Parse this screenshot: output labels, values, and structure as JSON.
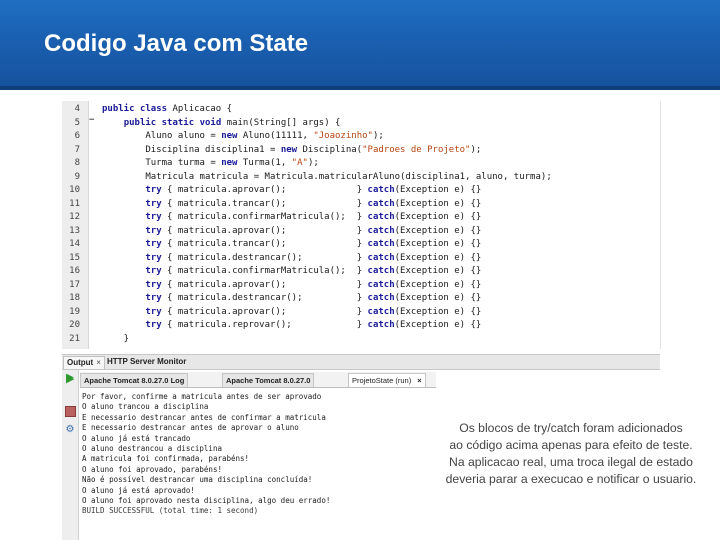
{
  "header": {
    "title": "Codigo Java com State"
  },
  "code": {
    "lines": [
      {
        "n": "4",
        "t": "public class Aplicacao {"
      },
      {
        "n": "5",
        "t": "    public static void main(String[] args) {"
      },
      {
        "n": "6",
        "t": "        Aluno aluno = new Aluno(11111, \"Joaozinho\");"
      },
      {
        "n": "7",
        "t": "        Disciplina disciplina1 = new Disciplina(\"Padroes de Projeto\");"
      },
      {
        "n": "8",
        "t": "        Turma turma = new Turma(1, \"A\");"
      },
      {
        "n": "9",
        "t": "        Matricula matricula = Matricula.matricularAluno(disciplina1, aluno, turma);"
      },
      {
        "n": "10",
        "t": "        try { matricula.aprovar();             } catch(Exception e) {}"
      },
      {
        "n": "11",
        "t": "        try { matricula.trancar();             } catch(Exception e) {}"
      },
      {
        "n": "12",
        "t": "        try { matricula.confirmarMatricula();  } catch(Exception e) {}"
      },
      {
        "n": "13",
        "t": "        try { matricula.aprovar();             } catch(Exception e) {}"
      },
      {
        "n": "14",
        "t": "        try { matricula.trancar();             } catch(Exception e) {}"
      },
      {
        "n": "15",
        "t": "        try { matricula.destrancar();          } catch(Exception e) {}"
      },
      {
        "n": "16",
        "t": "        try { matricula.confirmarMatricula();  } catch(Exception e) {}"
      },
      {
        "n": "17",
        "t": "        try { matricula.aprovar();             } catch(Exception e) {}"
      },
      {
        "n": "18",
        "t": "        try { matricula.destrancar();          } catch(Exception e) {}"
      },
      {
        "n": "19",
        "t": "        try { matricula.aprovar();             } catch(Exception e) {}"
      },
      {
        "n": "20",
        "t": "        try { matricula.reprovar();            } catch(Exception e) {}"
      },
      {
        "n": "21",
        "t": "    }"
      }
    ]
  },
  "output": {
    "panel_tabs": {
      "output": "Output",
      "server": "HTTP Server Monitor"
    },
    "sub_tabs": {
      "tomcat1": "Apache Tomcat 8.0.27.0 Log",
      "tomcat2": "Apache Tomcat 8.0.27.0",
      "project": "ProjetoState (run)"
    },
    "lines": [
      "Por favor, confirme a matricula antes de ser aprovado",
      "O aluno trancou a disciplina",
      "E necessario destrancar antes de confirmar a matricula",
      "E necessario destrancar antes de aprovar o aluno",
      "O aluno já está trancado",
      "O aluno destrancou a disciplina",
      "A matricula foi confirmada, parabéns!",
      "O aluno foi aprovado, parabéns!",
      "Não é possível destrancar uma disciplina concluída!",
      "O aluno já está aprovado!",
      "O aluno foi aprovado nesta disciplina, algo deu errado!",
      "BUILD SUCCESSFUL (total time: 1 second)"
    ]
  },
  "note": {
    "l1": "Os blocos de try/catch foram adicionados",
    "l2": "ao código acima apenas para efeito de teste.",
    "l3": "Na aplicacao real, uma troca ilegal de estado",
    "l4": "deveria parar a execucao e notificar o usuario."
  },
  "colors": {
    "header": "#1a5fb0",
    "keyword": "#1a1a9a",
    "string": "#b8440f",
    "run_green": "#2e9a2e"
  }
}
